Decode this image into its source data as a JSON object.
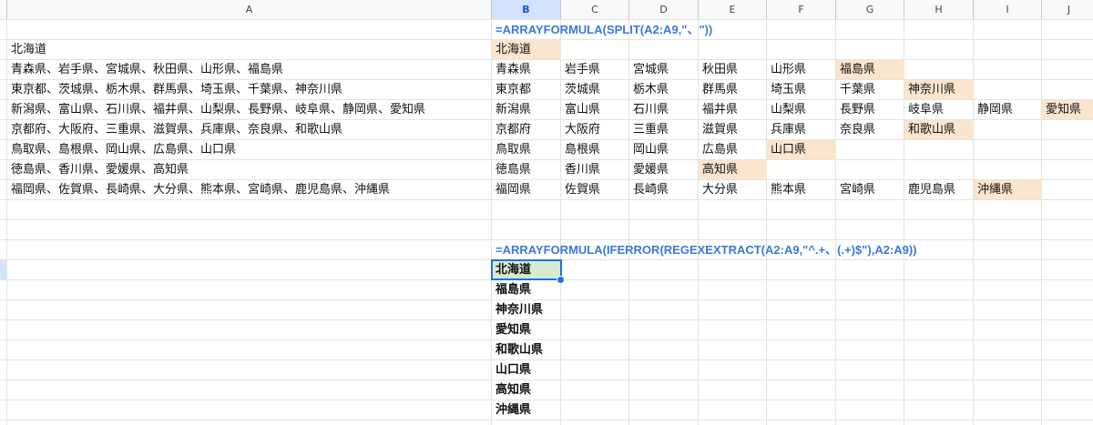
{
  "columns": [
    "A",
    "B",
    "C",
    "D",
    "E",
    "F",
    "G",
    "H",
    "I",
    "J"
  ],
  "selected_column": "B",
  "formula_split": "=ARRAYFORMULA(SPLIT(A2:A9,\"、\"))",
  "formula_regex": "=ARRAYFORMULA(IFERROR(REGEXEXTRACT(A2:A9,\"^.+、(.+)$\"),A2:A9))",
  "column_a": [
    "北海道",
    "青森県、岩手県、宮城県、秋田県、山形県、福島県",
    "東京都、茨城県、栃木県、群馬県、埼玉県、千葉県、神奈川県",
    "新潟県、富山県、石川県、福井県、山梨県、長野県、岐阜県、静岡県、愛知県",
    "京都府、大阪府、三重県、滋賀県、兵庫県、奈良県、和歌山県",
    "鳥取県、島根県、岡山県、広島県、山口県",
    "徳島県、香川県、愛媛県、高知県",
    "福岡県、佐賀県、長崎県、大分県、熊本県、宮崎県、鹿児島県、沖縄県"
  ],
  "split_rows": [
    [
      "北海道"
    ],
    [
      "青森県",
      "岩手県",
      "宮城県",
      "秋田県",
      "山形県",
      "福島県"
    ],
    [
      "東京都",
      "茨城県",
      "栃木県",
      "群馬県",
      "埼玉県",
      "千葉県",
      "神奈川県"
    ],
    [
      "新潟県",
      "富山県",
      "石川県",
      "福井県",
      "山梨県",
      "長野県",
      "岐阜県",
      "静岡県",
      "愛知県"
    ],
    [
      "京都府",
      "大阪府",
      "三重県",
      "滋賀県",
      "兵庫県",
      "奈良県",
      "和歌山県"
    ],
    [
      "鳥取県",
      "島根県",
      "岡山県",
      "広島県",
      "山口県"
    ],
    [
      "徳島県",
      "香川県",
      "愛媛県",
      "高知県"
    ],
    [
      "福岡県",
      "佐賀県",
      "長崎県",
      "大分県",
      "熊本県",
      "宮崎県",
      "鹿児島県",
      "沖縄県"
    ]
  ],
  "regex_results": [
    "北海道",
    "福島県",
    "神奈川県",
    "愛知県",
    "和歌山県",
    "山口県",
    "高知県",
    "沖縄県"
  ],
  "colors": {
    "highlight": "#fce5cd",
    "active_fill": "#d9ead3",
    "formula_text": "#3c78d8",
    "selection": "#1a73e8"
  }
}
